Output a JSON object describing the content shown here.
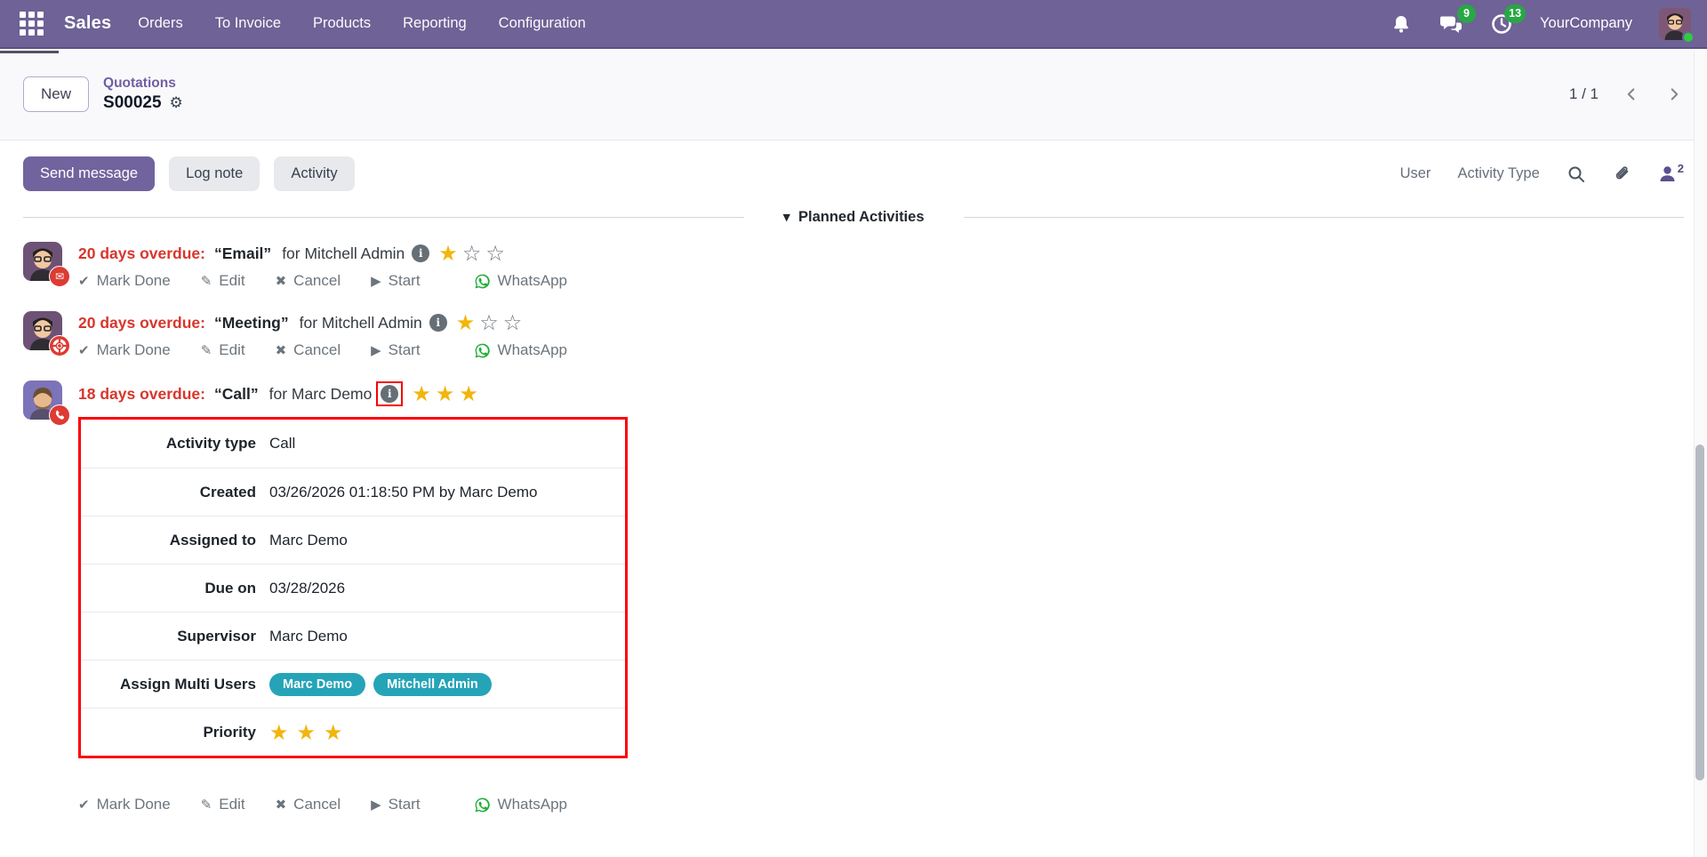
{
  "navbar": {
    "app_name": "Sales",
    "menu_items": [
      "Orders",
      "To Invoice",
      "Products",
      "Reporting",
      "Configuration"
    ],
    "messages_badge": "9",
    "activities_badge": "13",
    "company": "YourCompany"
  },
  "breadcrumb": {
    "new_button": "New",
    "parent": "Quotations",
    "current": "S00025",
    "pager": "1 / 1"
  },
  "chatter": {
    "send_message": "Send message",
    "log_note": "Log note",
    "activity": "Activity",
    "filter_user": "User",
    "filter_activity_type": "Activity Type",
    "followers_count": "2"
  },
  "activities": {
    "section_title": "Planned Activities",
    "actions": [
      "Mark Done",
      "Edit",
      "Cancel",
      "Start",
      "WhatsApp"
    ],
    "items": [
      {
        "overdue": "20 days overdue:",
        "name": "“Email”",
        "assignee": "for Mitchell Admin",
        "stars_filled": 1
      },
      {
        "overdue": "20 days overdue:",
        "name": "“Meeting”",
        "assignee": "for Mitchell Admin",
        "stars_filled": 1
      },
      {
        "overdue": "18 days overdue:",
        "name": "“Call”",
        "assignee": "for Marc Demo",
        "stars_filled": 3
      }
    ]
  },
  "popover": {
    "rows": [
      {
        "label": "Activity type",
        "value": "Call"
      },
      {
        "label": "Created",
        "value": "03/26/2026 01:18:50 PM by Marc Demo"
      },
      {
        "label": "Assigned to",
        "value": "Marc Demo"
      },
      {
        "label": "Due on",
        "value": "03/28/2026"
      },
      {
        "label": "Supervisor",
        "value": "Marc Demo"
      },
      {
        "label": "Assign Multi Users",
        "tags": [
          "Marc Demo",
          "Mitchell Admin"
        ]
      },
      {
        "label": "Priority"
      }
    ]
  },
  "icons": {
    "check": "✔",
    "edit": "✎",
    "cancel": "✖",
    "start": "▶",
    "gear": "⚙",
    "caret_down": "▼",
    "info": "i",
    "envelope": "✉",
    "star_filled": "★",
    "star_empty": "☆"
  },
  "colors": {
    "navbar_purple": "#6e6296",
    "primary_button_purple": "#71639d",
    "overdue_red": "#d8362c",
    "highlight_red": "#fb0007",
    "tag_teal": "#25a4b8",
    "star_gold": "#f2b50b",
    "badge_green": "#28a745",
    "whatsapp_green": "#1faf38"
  }
}
